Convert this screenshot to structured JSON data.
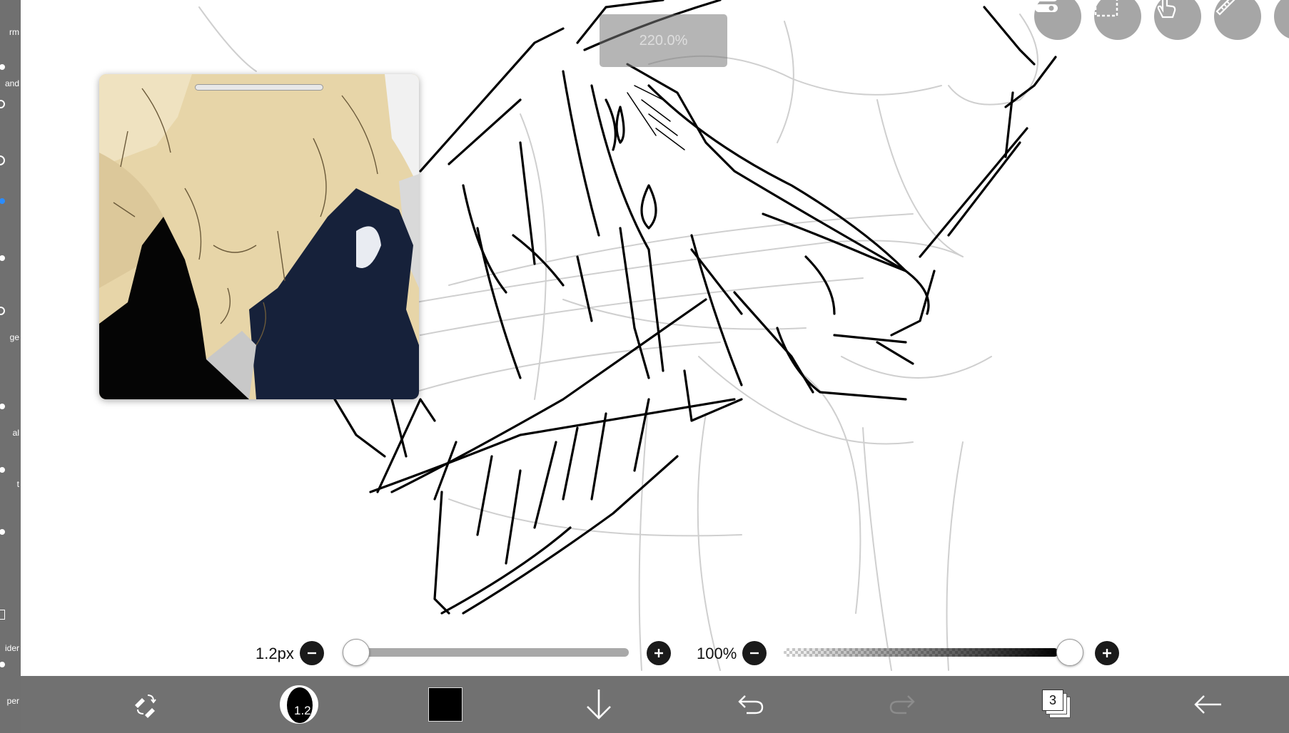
{
  "canvas": {
    "zoom_label": "220.0%"
  },
  "sidebar": {
    "labels": [
      "rm",
      "and",
      "ge",
      "al",
      "t",
      "ider",
      "per"
    ]
  },
  "top_toolbar": {
    "buttons": [
      {
        "name": "toggle-icon"
      },
      {
        "name": "selection-icon"
      },
      {
        "name": "gesture-icon"
      },
      {
        "name": "ruler-icon"
      }
    ]
  },
  "reference_window": {
    "title": ""
  },
  "brush_controls": {
    "size_label": "1.2px",
    "size_fraction": 0.0,
    "opacity_label": "100%",
    "opacity_fraction": 1.0
  },
  "bottom_toolbar": {
    "brush_size_badge": "1.2",
    "color_hex": "#000000",
    "layer_count": "3",
    "icons": [
      "transform-swap-icon",
      "brush-preview-icon",
      "color-swatch",
      "download-arrow-icon",
      "undo-icon",
      "redo-icon",
      "layers-icon",
      "back-arrow-icon"
    ]
  }
}
